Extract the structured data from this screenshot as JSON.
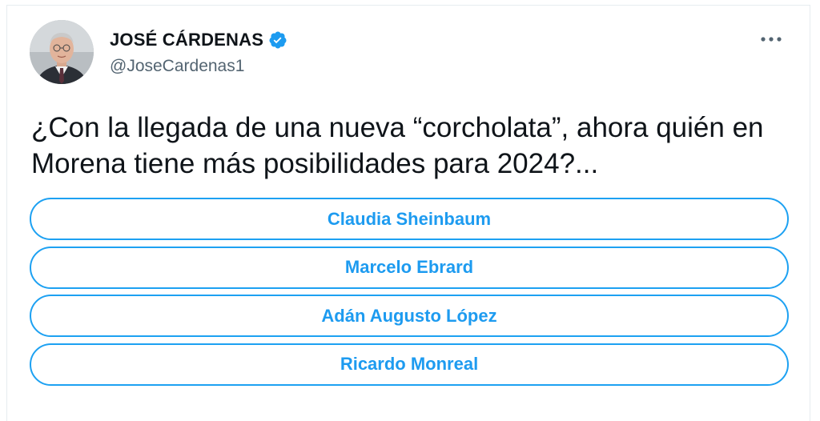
{
  "tweet": {
    "author": {
      "display_name": "JOSÉ CÁRDENAS",
      "handle": "@JoseCardenas1",
      "verified": true,
      "avatar_icon": "profile-photo"
    },
    "more_icon": "more-horizontal-icon",
    "text": "¿Con la llegada de una nueva “corcholata”, ahora quién en Morena tiene más posibilidades para 2024?...",
    "poll": {
      "options": [
        {
          "label": "Claudia Sheinbaum"
        },
        {
          "label": "Marcelo Ebrard"
        },
        {
          "label": "Adán Augusto López"
        },
        {
          "label": "Ricardo Monreal"
        }
      ]
    }
  },
  "colors": {
    "accent": "#1d9bf0",
    "border": "#1da1f2",
    "text_primary": "#0f1419",
    "text_secondary": "#536471"
  }
}
